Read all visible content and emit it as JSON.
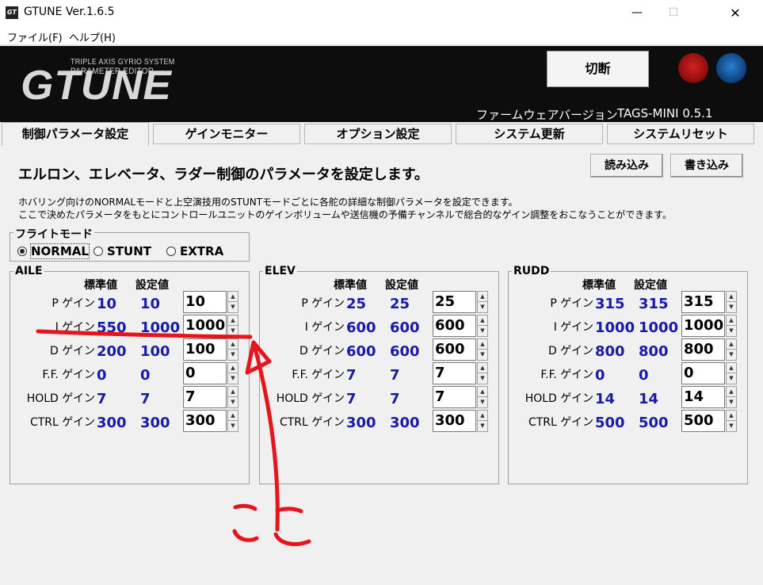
{
  "window": {
    "title": "GTUNE Ver.1.6.5",
    "app_icon_text": "GT"
  },
  "menu": {
    "file": "ファイル(F)",
    "help": "ヘルプ(H)"
  },
  "header": {
    "logo_line1": "TRIPLE AXIS GYRIO SYSTEM",
    "logo_line2": "PARAMETER EDITOR",
    "logo_main": "GTUNE",
    "disconnect_label": "切断",
    "firmware_label": "ファームウェアバージョン",
    "firmware_value": "TAGS-MINI  0.5.1"
  },
  "tabs": [
    {
      "label": "制御パラメータ設定"
    },
    {
      "label": "ゲインモニター"
    },
    {
      "label": "オプション設定"
    },
    {
      "label": "システム更新"
    },
    {
      "label": "システムリセット"
    }
  ],
  "content": {
    "title": "エルロン、エレベータ、ラダー制御のパラメータを設定します。",
    "line1": "ホバリング向けのNORMALモードと上空演技用のSTUNTモードごとに各舵の詳細な制御パラメータを設定できます。",
    "line2": "ここで決めたパラメータをもとにコントロールユニットのゲインボリュームや送信機の予備チャンネルで総合的なゲイン調整をおこなうことができます。",
    "read_button": "読み込み",
    "write_button": "書き込み"
  },
  "flight_mode": {
    "legend": "フライトモード",
    "options": [
      "NORMAL",
      "STUNT",
      "EXTRA"
    ],
    "selected": "NORMAL"
  },
  "column_headers": {
    "standard": "標準値",
    "setting": "設定値"
  },
  "row_labels": [
    "P ゲイン",
    "I ゲイン",
    "D ゲイン",
    "F.F. ゲイン",
    "HOLD ゲイン",
    "CTRL ゲイン"
  ],
  "groups": [
    {
      "name": "AILE",
      "rows": [
        {
          "std": "10",
          "cur": "10",
          "input": "10"
        },
        {
          "std": "550",
          "cur": "1000",
          "input": "1000"
        },
        {
          "std": "200",
          "cur": "100",
          "input": "100"
        },
        {
          "std": "0",
          "cur": "0",
          "input": "0"
        },
        {
          "std": "7",
          "cur": "7",
          "input": "7"
        },
        {
          "std": "300",
          "cur": "300",
          "input": "300"
        }
      ]
    },
    {
      "name": "ELEV",
      "rows": [
        {
          "std": "25",
          "cur": "25",
          "input": "25"
        },
        {
          "std": "600",
          "cur": "600",
          "input": "600"
        },
        {
          "std": "600",
          "cur": "600",
          "input": "600"
        },
        {
          "std": "7",
          "cur": "7",
          "input": "7"
        },
        {
          "std": "7",
          "cur": "7",
          "input": "7"
        },
        {
          "std": "300",
          "cur": "300",
          "input": "300"
        }
      ]
    },
    {
      "name": "RUDD",
      "rows": [
        {
          "std": "315",
          "cur": "315",
          "input": "315"
        },
        {
          "std": "1000",
          "cur": "1000",
          "input": "1000"
        },
        {
          "std": "800",
          "cur": "800",
          "input": "800"
        },
        {
          "std": "0",
          "cur": "0",
          "input": "0"
        },
        {
          "std": "14",
          "cur": "14",
          "input": "14"
        },
        {
          "std": "500",
          "cur": "500",
          "input": "500"
        }
      ]
    }
  ],
  "annotation": {
    "text": "ここ",
    "color": "#e8141b"
  }
}
